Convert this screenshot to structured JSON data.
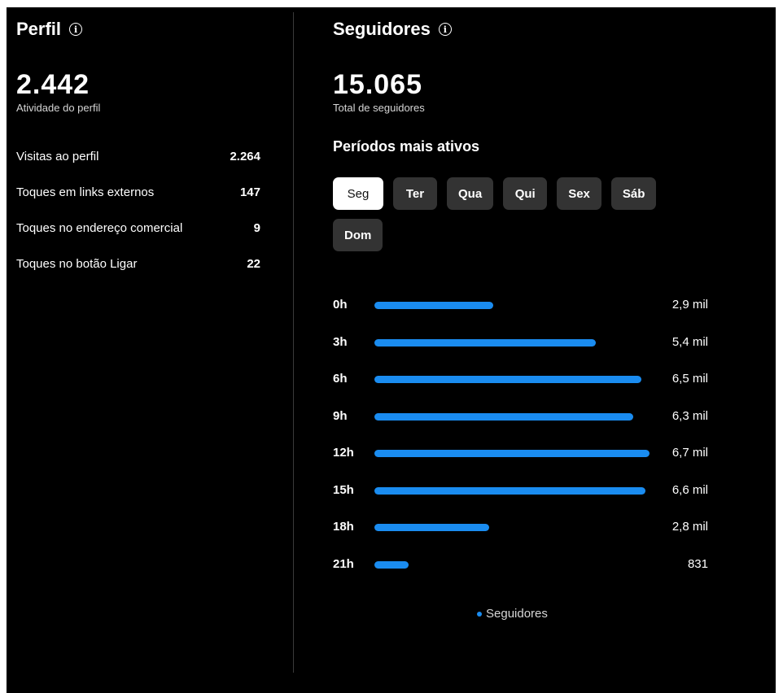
{
  "profile": {
    "title": "Perfil",
    "total": "2.442",
    "total_caption": "Atividade do perfil",
    "stats": [
      {
        "label": "Visitas ao perfil",
        "value": "2.264"
      },
      {
        "label": "Toques em links externos",
        "value": "147"
      },
      {
        "label": "Toques no endereço comercial",
        "value": "9"
      },
      {
        "label": "Toques no botão Ligar",
        "value": "22"
      }
    ]
  },
  "followers": {
    "title": "Seguidores",
    "total": "15.065",
    "total_caption": "Total de seguidores",
    "periods_title": "Períodos mais ativos",
    "days": [
      "Seg",
      "Ter",
      "Qua",
      "Qui",
      "Sex",
      "Sáb",
      "Dom"
    ],
    "selected_day": "Seg",
    "legend": "Seguidores"
  },
  "colors": {
    "accent": "#1a8cf0",
    "background": "#000000",
    "chip": "#333333"
  },
  "chart_data": {
    "type": "bar",
    "orientation": "horizontal",
    "categories": [
      "0h",
      "3h",
      "6h",
      "9h",
      "12h",
      "15h",
      "18h",
      "21h"
    ],
    "values": [
      2900,
      5400,
      6500,
      6300,
      6700,
      6600,
      2800,
      831
    ],
    "value_labels": [
      "2,9 mil",
      "5,4 mil",
      "6,5 mil",
      "6,3 mil",
      "6,7 mil",
      "6,6 mil",
      "2,8 mil",
      "831"
    ],
    "series": [
      {
        "name": "Seguidores",
        "values": [
          2900,
          5400,
          6500,
          6300,
          6700,
          6600,
          2800,
          831
        ]
      }
    ],
    "xlim": [
      0,
      6700
    ],
    "legend": "bottom-center"
  }
}
